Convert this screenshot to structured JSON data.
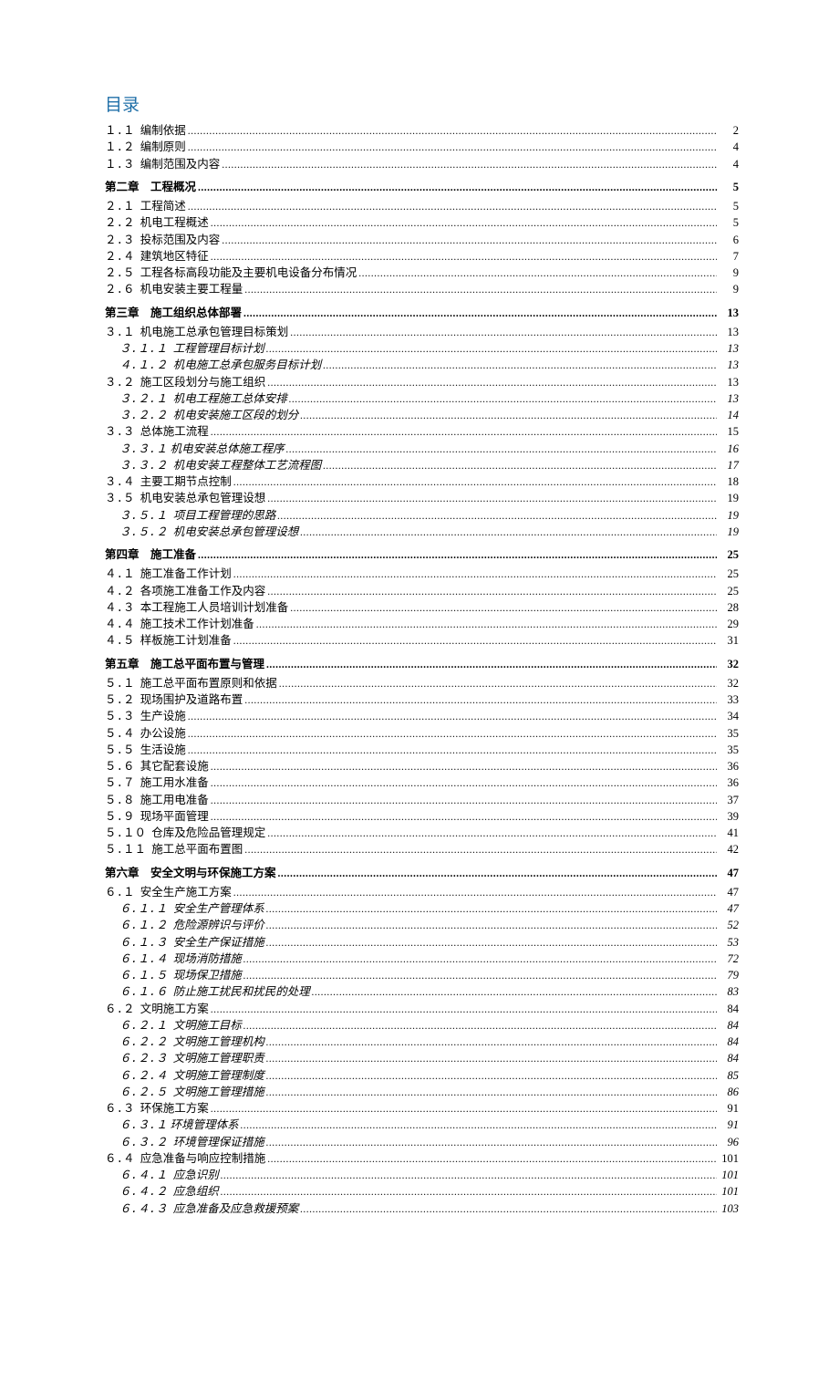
{
  "title": "目录",
  "entries": [
    {
      "num": "１.１",
      "label": "  编制依据",
      "page": "2",
      "cls": "level2"
    },
    {
      "num": "１.２",
      "label": "  编制原则",
      "page": "4",
      "cls": "level2"
    },
    {
      "num": "１.３",
      "label": "  编制范围及内容",
      "page": "4",
      "cls": "level2"
    },
    {
      "num": "第二章",
      "label": "    工程概况",
      "page": "5",
      "cls": "chapter"
    },
    {
      "num": "２.１",
      "label": "  工程简述",
      "page": "5",
      "cls": "level2"
    },
    {
      "num": "２.２",
      "label": "  机电工程概述",
      "page": "5",
      "cls": "level2"
    },
    {
      "num": "２.３",
      "label": "  投标范围及内容",
      "page": "6",
      "cls": "level2"
    },
    {
      "num": "２.４",
      "label": "  建筑地区特征",
      "page": "7",
      "cls": "level2"
    },
    {
      "num": "２.５",
      "label": "  工程各标高段功能及主要机电设备分布情况",
      "page": "9",
      "cls": "level2"
    },
    {
      "num": "２.６",
      "label": "  机电安装主要工程量",
      "page": "9",
      "cls": "level2"
    },
    {
      "num": "第三章",
      "label": "    施工组织总体部署",
      "page": "13",
      "cls": "chapter"
    },
    {
      "num": "３.１",
      "label": "  机电施工总承包管理目标策划",
      "page": "13",
      "cls": "level2"
    },
    {
      "num": "３.１.１",
      "label": "  工程管理目标计划",
      "page": "13",
      "cls": "sub"
    },
    {
      "num": "４.１.２",
      "label": "  机电施工总承包服务目标计划",
      "page": "13",
      "cls": "sub"
    },
    {
      "num": "３.２",
      "label": "  施工区段划分与施工组织",
      "page": "13",
      "cls": "level2"
    },
    {
      "num": "３.２.１",
      "label": "  机电工程施工总体安排",
      "page": "13",
      "cls": "sub"
    },
    {
      "num": "３.２.２",
      "label": "  机电安装施工区段的划分",
      "page": "14",
      "cls": "sub"
    },
    {
      "num": "３.３",
      "label": "  总体施工流程",
      "page": "15",
      "cls": "level2"
    },
    {
      "num": "３.３.１",
      "label": " 机电安装总体施工程序",
      "page": "16",
      "cls": "sub"
    },
    {
      "num": "３.３.２",
      "label": "  机电安装工程整体工艺流程图",
      "page": "17",
      "cls": "sub"
    },
    {
      "num": "３.４",
      "label": "  主要工期节点控制",
      "page": "18",
      "cls": "level2"
    },
    {
      "num": "３.５",
      "label": "  机电安装总承包管理设想",
      "page": "19",
      "cls": "level2"
    },
    {
      "num": "３.５.１",
      "label": "  项目工程管理的思路",
      "page": "19",
      "cls": "sub"
    },
    {
      "num": "３.５.２",
      "label": "  机电安装总承包管理设想",
      "page": "19",
      "cls": "sub"
    },
    {
      "num": "第四章",
      "label": "    施工准备",
      "page": "25",
      "cls": "chapter"
    },
    {
      "num": "４.１",
      "label": "  施工准备工作计划",
      "page": "25",
      "cls": "level2"
    },
    {
      "num": "４.２",
      "label": "  各项施工准备工作及内容",
      "page": "25",
      "cls": "level2"
    },
    {
      "num": "４.３",
      "label": "  本工程施工人员培训计划准备",
      "page": "28",
      "cls": "level2"
    },
    {
      "num": "４.４",
      "label": "  施工技术工作计划准备",
      "page": "29",
      "cls": "level2"
    },
    {
      "num": "４.５",
      "label": "  样板施工计划准备",
      "page": "31",
      "cls": "level2"
    },
    {
      "num": "第五章",
      "label": "    施工总平面布置与管理",
      "page": "32",
      "cls": "chapter"
    },
    {
      "num": "５.１",
      "label": "  施工总平面布置原则和依据",
      "page": "32",
      "cls": "level2"
    },
    {
      "num": "５.２",
      "label": "  现场围护及道路布置",
      "page": "33",
      "cls": "level2"
    },
    {
      "num": "５.３",
      "label": "  生产设施",
      "page": "34",
      "cls": "level2"
    },
    {
      "num": "５.４",
      "label": "  办公设施",
      "page": "35",
      "cls": "level2"
    },
    {
      "num": "５.５",
      "label": "  生活设施",
      "page": "35",
      "cls": "level2"
    },
    {
      "num": "５.６",
      "label": "  其它配套设施",
      "page": "36",
      "cls": "level2"
    },
    {
      "num": "５.７",
      "label": "  施工用水准备",
      "page": "36",
      "cls": "level2"
    },
    {
      "num": "５.８",
      "label": "  施工用电准备",
      "page": "37",
      "cls": "level2"
    },
    {
      "num": "５.９",
      "label": "  现场平面管理",
      "page": "39",
      "cls": "level2"
    },
    {
      "num": "５.１０",
      "label": "  仓库及危险品管理规定",
      "page": "41",
      "cls": "level2"
    },
    {
      "num": "５.１１",
      "label": "  施工总平面布置图",
      "page": "42",
      "cls": "level2"
    },
    {
      "num": "第六章",
      "label": "    安全文明与环保施工方案",
      "page": "47",
      "cls": "chapter"
    },
    {
      "num": "６.１",
      "label": "  安全生产施工方案",
      "page": "47",
      "cls": "level2"
    },
    {
      "num": "６.１.１",
      "label": "  安全生产管理体系",
      "page": "47",
      "cls": "sub"
    },
    {
      "num": "６.１.２",
      "label": "  危险源辨识与评价",
      "page": "52",
      "cls": "sub"
    },
    {
      "num": "６.１.３",
      "label": "  安全生产保证措施",
      "page": "53",
      "cls": "sub"
    },
    {
      "num": "６.１.４",
      "label": "  现场消防措施",
      "page": "72",
      "cls": "sub"
    },
    {
      "num": "６.１.５",
      "label": "  现场保卫措施",
      "page": "79",
      "cls": "sub"
    },
    {
      "num": "６.１.６",
      "label": "  防止施工扰民和扰民的处理",
      "page": "83",
      "cls": "sub"
    },
    {
      "num": "６.２",
      "label": "  文明施工方案",
      "page": "84",
      "cls": "level2"
    },
    {
      "num": "６.２.１",
      "label": "  文明施工目标",
      "page": "84",
      "cls": "sub"
    },
    {
      "num": "６.２.２",
      "label": "  文明施工管理机构",
      "page": "84",
      "cls": "sub"
    },
    {
      "num": "６.２.３",
      "label": "  文明施工管理职责",
      "page": "84",
      "cls": "sub"
    },
    {
      "num": "６.２.４",
      "label": "  文明施工管理制度",
      "page": "85",
      "cls": "sub"
    },
    {
      "num": "６.２.５",
      "label": "  文明施工管理措施",
      "page": "86",
      "cls": "sub"
    },
    {
      "num": "６.３",
      "label": "  环保施工方案",
      "page": "91",
      "cls": "level2"
    },
    {
      "num": "６.３.１",
      "label": " 环境管理体系",
      "page": "91",
      "cls": "sub"
    },
    {
      "num": "６.３.２",
      "label": "  环境管理保证措施",
      "page": "96",
      "cls": "sub"
    },
    {
      "num": "６.４",
      "label": "  应急准备与响应控制措施",
      "page": "101",
      "cls": "level2"
    },
    {
      "num": "６.４.１",
      "label": "  应急识别",
      "page": "101",
      "cls": "sub"
    },
    {
      "num": "６.４.２",
      "label": "  应急组织",
      "page": "101",
      "cls": "sub"
    },
    {
      "num": "６.４.３",
      "label": "  应急准备及应急救援预案",
      "page": "103",
      "cls": "sub"
    }
  ]
}
